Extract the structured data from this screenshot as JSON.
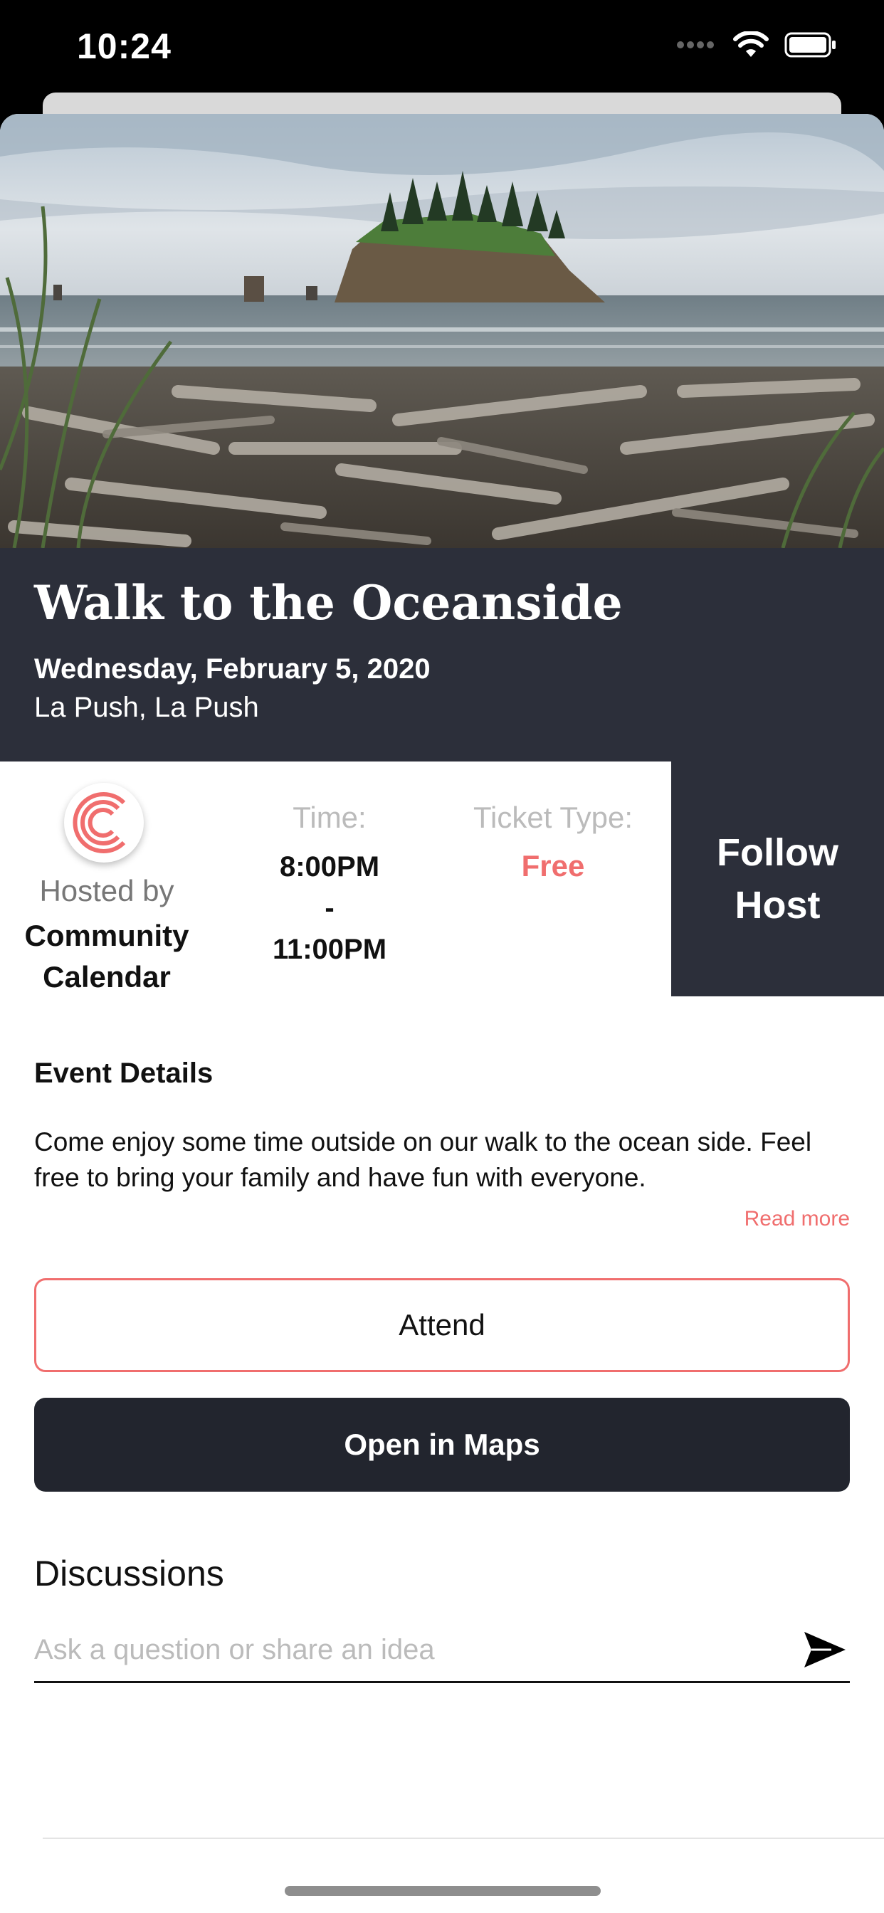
{
  "status_bar": {
    "time": "10:24"
  },
  "event": {
    "title": "Walk to the Oceanside",
    "date": "Wednesday, February 5, 2020",
    "location": "La Push, La Push"
  },
  "host": {
    "hosted_by_label": "Hosted by",
    "name": "Community Calendar"
  },
  "time": {
    "label": "Time:",
    "start": "8:00PM",
    "separator": "-",
    "end": "11:00PM"
  },
  "ticket": {
    "label": "Ticket Type:",
    "value": "Free"
  },
  "follow_button": {
    "label": "Follow Host"
  },
  "details": {
    "heading": "Event Details",
    "body": "Come enjoy some time outside on our walk to the ocean side. Feel free to bring your family and have fun with everyone.",
    "read_more": "Read more"
  },
  "actions": {
    "attend": "Attend",
    "open_maps": "Open in Maps"
  },
  "discussions": {
    "heading": "Discussions",
    "placeholder": "Ask a question or share an idea"
  },
  "colors": {
    "accent": "#f06e6e",
    "dark": "#2c2f3a",
    "button_dark": "#22252e"
  },
  "icons": {
    "signal": "cellular-signal-icon",
    "wifi": "wifi-icon",
    "battery": "battery-icon",
    "send": "send-icon",
    "host_logo": "community-calendar-logo"
  }
}
